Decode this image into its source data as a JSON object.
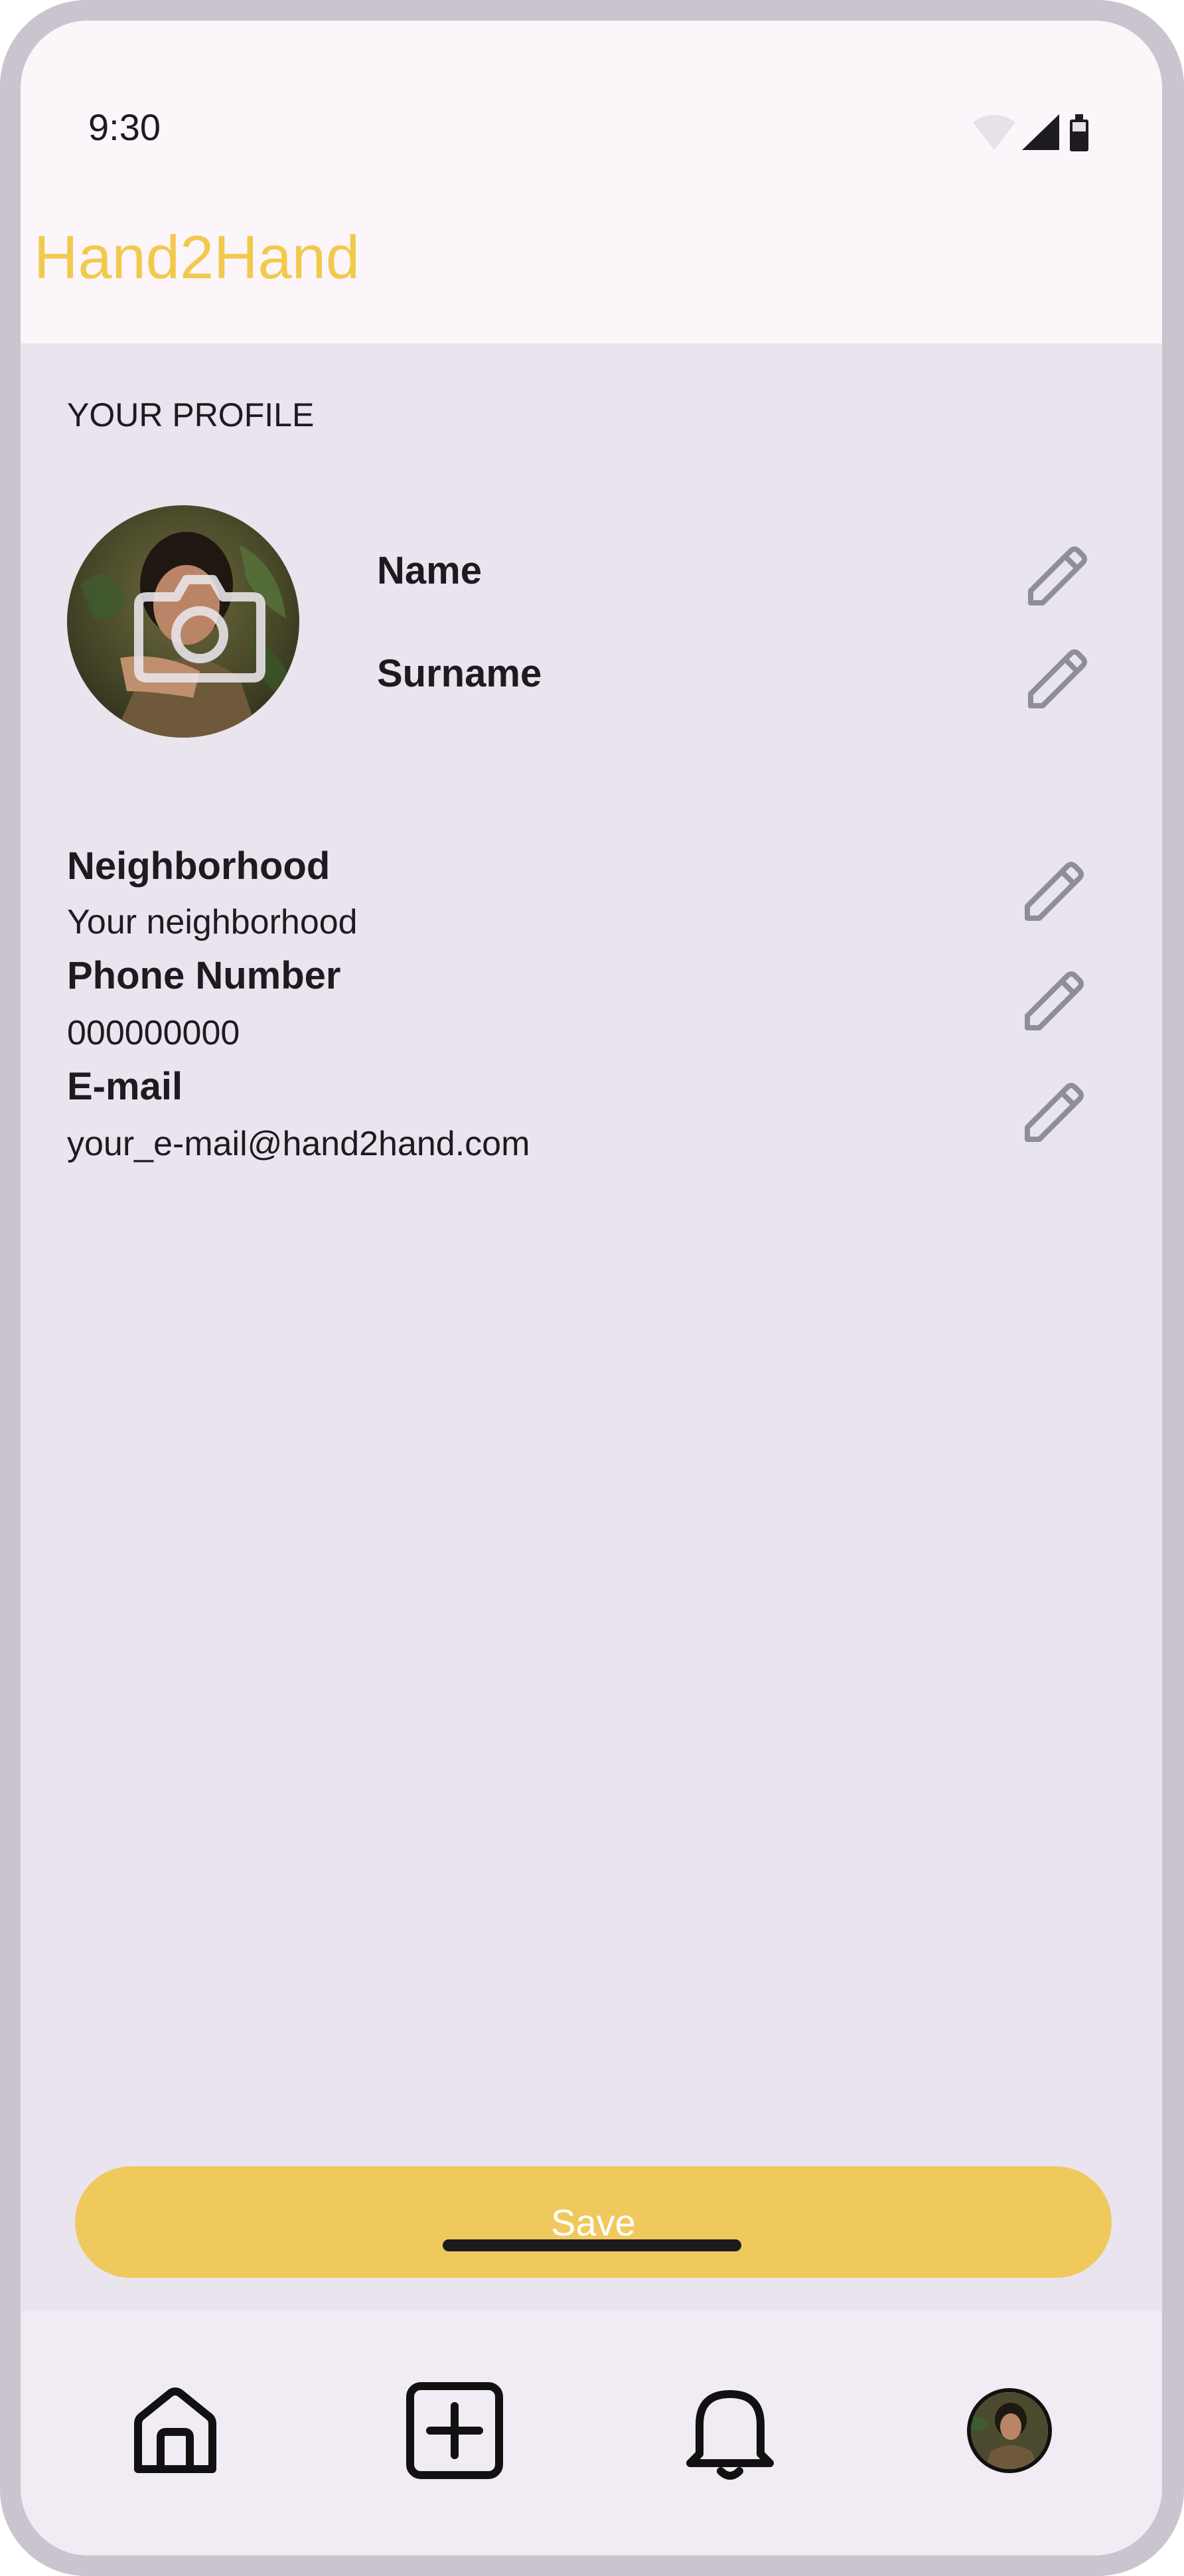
{
  "status_bar": {
    "time": "9:30",
    "icons": [
      "wifi-icon",
      "signal-icon",
      "battery-icon"
    ]
  },
  "app_bar": {
    "title": "Hand2Hand",
    "title_color": "#f2c94c"
  },
  "profile": {
    "section_title": "YOUR PROFILE",
    "avatar_icon": "camera-icon",
    "name_label": "Name",
    "surname_label": "Surname",
    "fields": [
      {
        "label": "Neighborhood",
        "value": "Your neighborhood"
      },
      {
        "label": "Phone Number",
        "value": "000000000"
      },
      {
        "label": "E-mail",
        "value": "your_e-mail@hand2hand.com"
      }
    ],
    "edit_icon": "pencil-icon"
  },
  "actions": {
    "save_label": "Save",
    "save_color": "#f0c95d"
  },
  "bottom_nav": {
    "items": [
      {
        "icon": "home-icon"
      },
      {
        "icon": "add-box-icon"
      },
      {
        "icon": "bell-icon"
      },
      {
        "icon": "profile-avatar"
      }
    ]
  }
}
